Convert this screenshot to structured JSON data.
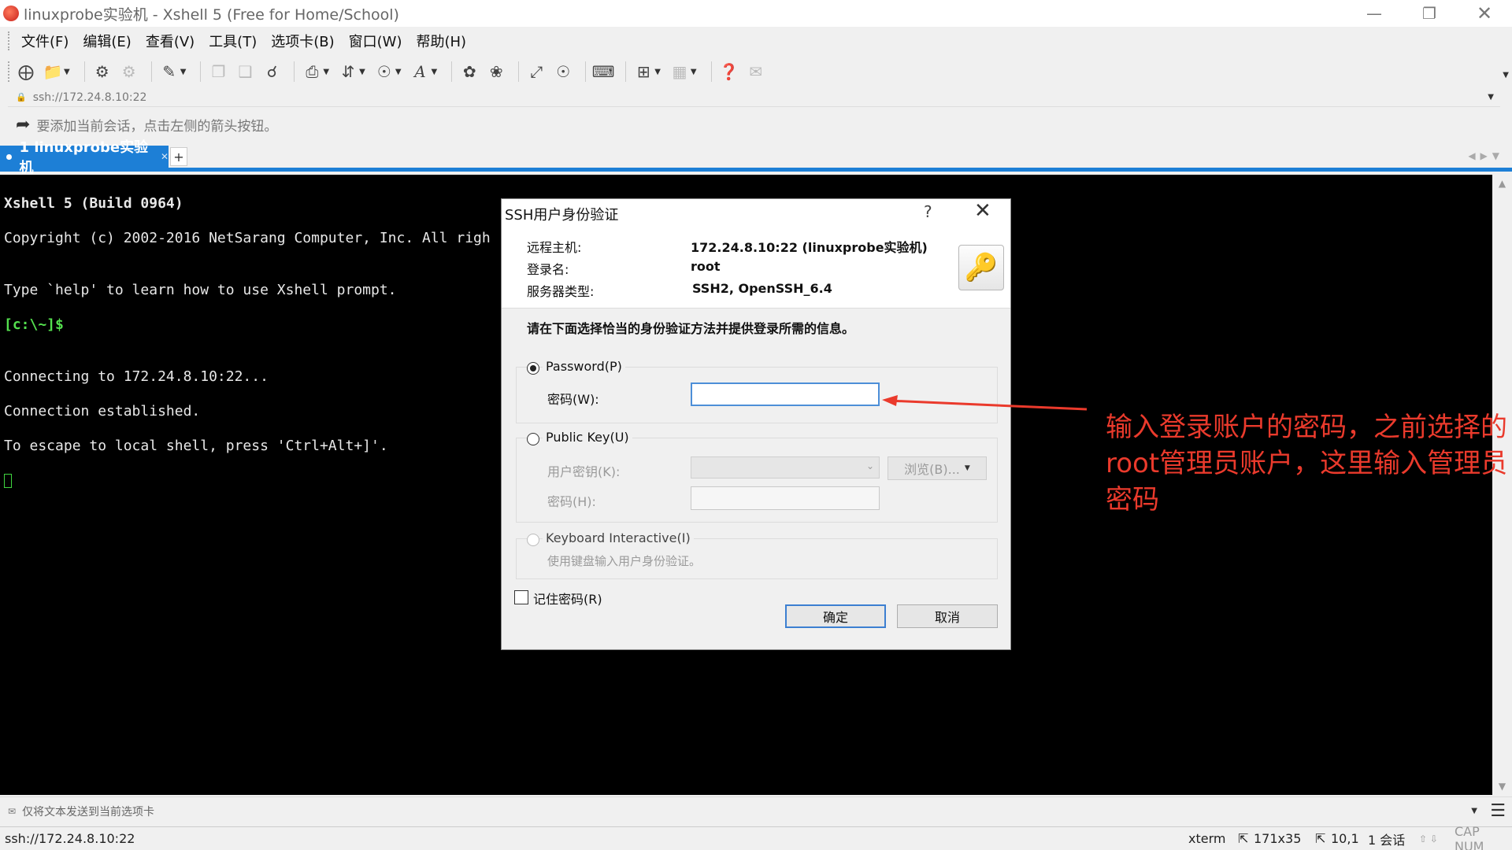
{
  "window": {
    "title": "linuxprobe实验机 - Xshell 5 (Free for Home/School)"
  },
  "menu": [
    "文件(F)",
    "编辑(E)",
    "查看(V)",
    "工具(T)",
    "选项卡(B)",
    "窗口(W)",
    "帮助(H)"
  ],
  "address": {
    "url": "ssh://172.24.8.10:22"
  },
  "hint": {
    "text": "要添加当前会话，点击左侧的箭头按钮。"
  },
  "tabs": [
    {
      "label": "1 linuxprobe实验机",
      "active": true
    }
  ],
  "terminal": {
    "lines": [
      "Xshell 5 (Build 0964)",
      "Copyright (c) 2002-2016 NetSarang Computer, Inc. All righ",
      "",
      "Type `help' to learn how to use Xshell prompt.",
      "[c:\\~]$",
      "",
      "Connecting to 172.24.8.10:22...",
      "Connection established.",
      "To escape to local shell, press 'Ctrl+Alt+]'."
    ]
  },
  "dialog": {
    "title": "SSH用户身份验证",
    "help": "?",
    "remote_host_label": "远程主机:",
    "remote_host_value": "172.24.8.10:22 (linuxprobe实验机)",
    "login_label": "登录名:",
    "login_value": "root",
    "server_type_label": "服务器类型:",
    "server_type_value": "SSH2, OpenSSH_6.4",
    "instruction": "请在下面选择恰当的身份验证方法并提供登录所需的信息。",
    "password_option": "Password(P)",
    "password_field_label": "密码(W):",
    "password_value": "",
    "pubkey_option": "Public Key(U)",
    "user_key_label": "用户密钥(K):",
    "browse_label": "浏览(B)...",
    "pubkey_password_label": "密码(H):",
    "keyboard_option": "Keyboard Interactive(I)",
    "keyboard_desc": "使用键盘输入用户身份验证。",
    "remember_label": "记住密码(R)",
    "ok_label": "确定",
    "cancel_label": "取消"
  },
  "annotation": {
    "text": "输入登录账户的密码，之前选择的root管理员账户，这里输入管理员密码",
    "color": "#ea3a2c"
  },
  "compose": {
    "text": "仅将文本发送到当前选项卡"
  },
  "status": {
    "connection": "ssh://172.24.8.10:22",
    "term": "xterm",
    "size": "171x35",
    "cursor_pos": "10,1",
    "sessions": "1 会话",
    "keys": "CAP NUM"
  },
  "colors": {
    "accent": "#1d7fd6",
    "prompt": "#54e04e"
  }
}
